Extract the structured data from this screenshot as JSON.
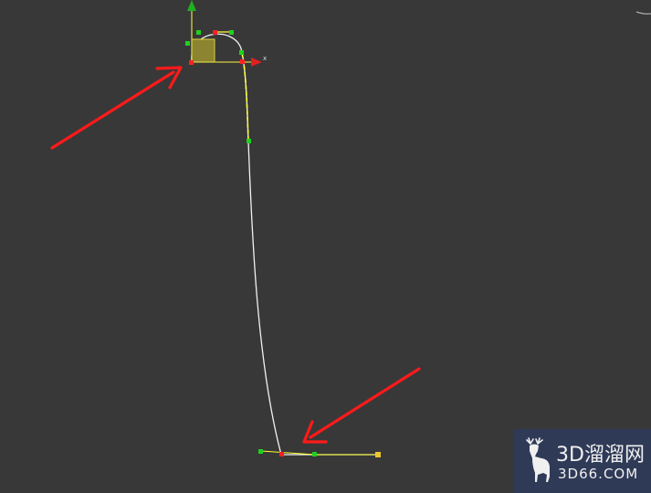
{
  "viewport": {
    "background": "#383838",
    "axis_labels": {
      "x": "x"
    },
    "colors": {
      "spline": "#f2f2f2",
      "selected_segment": "#ffff33",
      "vertex_first": "#ff2020",
      "vertex": "#20d020",
      "vertex_end": "#e8c830",
      "gizmo_x": "#e02020",
      "gizmo_y": "#20b020",
      "gizmo_plane": "#8c8430",
      "annotation_arrow": "#ff1a1a"
    }
  },
  "watermark": {
    "logo_icon": "deer-icon",
    "brand_cn": "3D溜溜网",
    "brand_url": "3D66.COM",
    "background": "#2f3a57"
  }
}
